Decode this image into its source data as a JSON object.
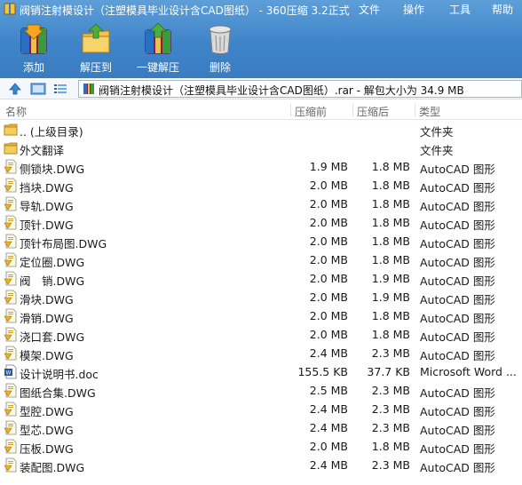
{
  "window": {
    "title": "阀销注射模设计（注塑模具毕业设计含CAD图纸） - 360压缩 3.2正式",
    "menus": [
      "文件",
      "操作",
      "工具",
      "帮助"
    ]
  },
  "toolbar": {
    "add": "添加",
    "extract_to": "解压到",
    "one_click_extract": "一键解压",
    "delete": "删除"
  },
  "address": {
    "path": "阀销注射模设计（注塑模具毕业设计含CAD图纸）.rar - 解包大小为 34.9 MB"
  },
  "columns": {
    "name": "名称",
    "original": "压缩前",
    "compressed": "压缩后",
    "type": "类型"
  },
  "colors": {
    "titlebar": "#4a8fd0",
    "folder": "#f2c14e",
    "dwg_paper": "#fffbe0"
  },
  "files": [
    {
      "icon": "folder-icon",
      "name": ".. (上级目录)",
      "original": "",
      "compressed": "",
      "type": "文件夹"
    },
    {
      "icon": "folder-icon",
      "name": "外文翻译",
      "original": "",
      "compressed": "",
      "type": "文件夹"
    },
    {
      "icon": "dwg-file-icon",
      "name": "侧锁块.DWG",
      "original": "1.9 MB",
      "compressed": "1.8 MB",
      "type": "AutoCAD 图形"
    },
    {
      "icon": "dwg-file-icon",
      "name": "挡块.DWG",
      "original": "2.0 MB",
      "compressed": "1.8 MB",
      "type": "AutoCAD 图形"
    },
    {
      "icon": "dwg-file-icon",
      "name": "导轨.DWG",
      "original": "2.0 MB",
      "compressed": "1.8 MB",
      "type": "AutoCAD 图形"
    },
    {
      "icon": "dwg-file-icon",
      "name": "顶针.DWG",
      "original": "2.0 MB",
      "compressed": "1.8 MB",
      "type": "AutoCAD 图形"
    },
    {
      "icon": "dwg-file-icon",
      "name": "顶针布局图.DWG",
      "original": "2.0 MB",
      "compressed": "1.8 MB",
      "type": "AutoCAD 图形"
    },
    {
      "icon": "dwg-file-icon",
      "name": "定位圈.DWG",
      "original": "2.0 MB",
      "compressed": "1.8 MB",
      "type": "AutoCAD 图形"
    },
    {
      "icon": "dwg-file-icon",
      "name": "阀　销.DWG",
      "original": "2.0 MB",
      "compressed": "1.9 MB",
      "type": "AutoCAD 图形"
    },
    {
      "icon": "dwg-file-icon",
      "name": "滑块.DWG",
      "original": "2.0 MB",
      "compressed": "1.9 MB",
      "type": "AutoCAD 图形"
    },
    {
      "icon": "dwg-file-icon",
      "name": "滑销.DWG",
      "original": "2.0 MB",
      "compressed": "1.8 MB",
      "type": "AutoCAD 图形"
    },
    {
      "icon": "dwg-file-icon",
      "name": "浇口套.DWG",
      "original": "2.0 MB",
      "compressed": "1.8 MB",
      "type": "AutoCAD 图形"
    },
    {
      "icon": "dwg-file-icon",
      "name": "模架.DWG",
      "original": "2.4 MB",
      "compressed": "2.3 MB",
      "type": "AutoCAD 图形"
    },
    {
      "icon": "doc-file-icon",
      "name": "设计说明书.doc",
      "original": "155.5 KB",
      "compressed": "37.7 KB",
      "type": "Microsoft Word ..."
    },
    {
      "icon": "dwg-file-icon",
      "name": "图纸合集.DWG",
      "original": "2.5 MB",
      "compressed": "2.3 MB",
      "type": "AutoCAD 图形"
    },
    {
      "icon": "dwg-file-icon",
      "name": "型腔.DWG",
      "original": "2.4 MB",
      "compressed": "2.3 MB",
      "type": "AutoCAD 图形"
    },
    {
      "icon": "dwg-file-icon",
      "name": "型芯.DWG",
      "original": "2.4 MB",
      "compressed": "2.3 MB",
      "type": "AutoCAD 图形"
    },
    {
      "icon": "dwg-file-icon",
      "name": "压板.DWG",
      "original": "2.0 MB",
      "compressed": "1.8 MB",
      "type": "AutoCAD 图形"
    },
    {
      "icon": "dwg-file-icon",
      "name": "装配图.DWG",
      "original": "2.4 MB",
      "compressed": "2.3 MB",
      "type": "AutoCAD 图形"
    }
  ]
}
